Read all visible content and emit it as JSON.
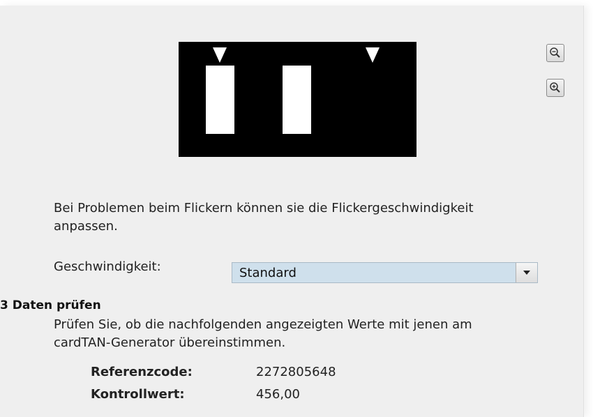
{
  "flicker": {
    "markers": 2,
    "bars": 2
  },
  "zoom": {
    "out_icon": "zoom-out-icon",
    "in_icon": "zoom-in-icon"
  },
  "info": {
    "line1": "Bei Problemen beim Flickern können sie die Flickergeschwindigkeit",
    "line2": "anpassen."
  },
  "speed": {
    "label": "Geschwindigkeit:",
    "value": "Standard"
  },
  "step3": {
    "heading": "3 Daten prüfen",
    "line1": "Prüfen Sie, ob die nachfolgenden angezeigten Werte mit jenen am",
    "line2": "cardTAN-Generator übereinstimmen."
  },
  "values": {
    "ref_label": "Referenzcode:",
    "ref_value": "2272805648",
    "control_label": "Kontrollwert:",
    "control_value": "456,00"
  }
}
